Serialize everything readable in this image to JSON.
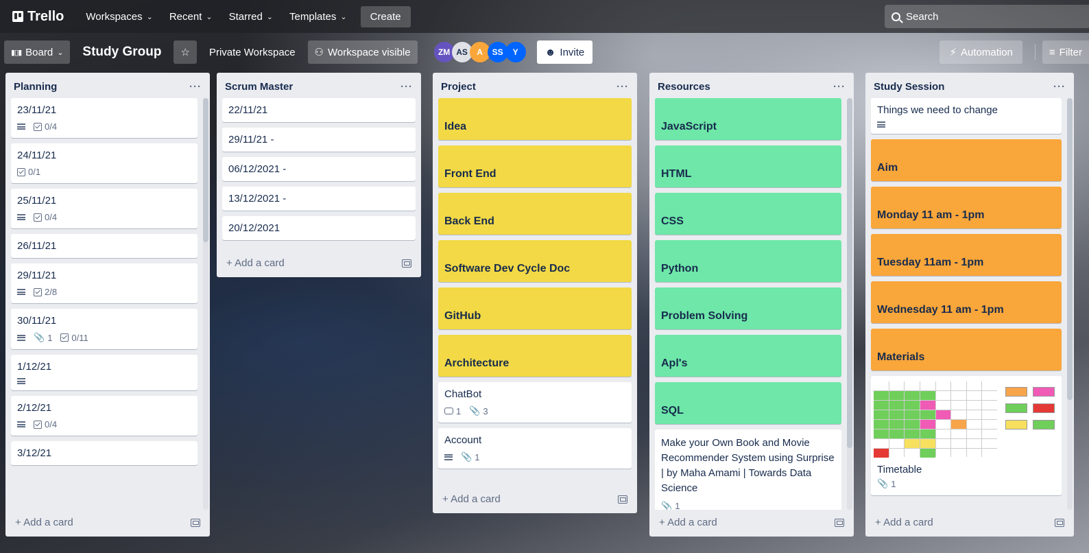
{
  "topnav": {
    "logo": "Trello",
    "items": [
      "Workspaces",
      "Recent",
      "Starred",
      "Templates"
    ],
    "create": "Create",
    "search": "Search"
  },
  "boardbar": {
    "view": "Board",
    "title": "Study Group",
    "workspace": "Private Workspace",
    "visibility": "Workspace visible",
    "avatars": [
      {
        "initials": "ZM",
        "color": "#6554c0"
      },
      {
        "initials": "AS",
        "color": "#dfe1e6"
      },
      {
        "initials": "A",
        "color": "#f9a63a"
      },
      {
        "initials": "SS",
        "color": "#0065ff"
      },
      {
        "initials": "Y",
        "color": "#0065ff"
      }
    ],
    "invite": "Invite",
    "automation": "Automation",
    "filter": "Filter"
  },
  "lists": {
    "planning": {
      "title": "Planning",
      "add": "Add a card",
      "cards": [
        {
          "title": "23/11/21",
          "checklist": "0/4"
        },
        {
          "title": "24/11/21",
          "checklist": "0/1"
        },
        {
          "title": "25/11/21",
          "checklist": "0/4"
        },
        {
          "title": "26/11/21"
        },
        {
          "title": "29/11/21",
          "checklist": "2/8"
        },
        {
          "title": "30/11/21",
          "attachments": "1",
          "checklist": "0/11"
        },
        {
          "title": "1/12/21"
        },
        {
          "title": "2/12/21",
          "checklist": "0/4"
        },
        {
          "title": "3/12/21"
        }
      ]
    },
    "scrum": {
      "title": "Scrum Master",
      "add": "Add a card",
      "cards": [
        "22/11/21",
        "29/11/21 -",
        "06/12/2021 -",
        "13/12/2021 -",
        "20/12/2021"
      ]
    },
    "project": {
      "title": "Project",
      "add": "Add a card",
      "cards": [
        "Idea",
        "Front End",
        "Back End",
        "Software Dev Cycle Doc",
        "GitHub",
        "Architecture"
      ],
      "chatbot": {
        "title": "ChatBot",
        "comments": "1",
        "attachments": "3"
      },
      "account": {
        "title": "Account",
        "attachments": "1"
      }
    },
    "resources": {
      "title": "Resources",
      "add": "Add a card",
      "cards": [
        "JavaScript",
        "HTML",
        "CSS",
        "Python",
        "Problem Solving",
        "Apl's",
        "SQL"
      ],
      "link_card": {
        "title": "Make your Own Book and Movie Recommender System using Surprise | by Maha Amami | Towards Data Science",
        "attachments": "1"
      }
    },
    "study": {
      "title": "Study Session",
      "add": "Add a card",
      "first": "Things we need to change",
      "cards": [
        "Aim",
        "Monday 11 am - 1pm",
        "Tuesday 11am - 1pm",
        "Wednesday 11 am - 1pm",
        "Materials"
      ],
      "timetable": {
        "title": "Timetable",
        "attachments": "1"
      }
    }
  },
  "colors": {
    "yellow": "#f2d945",
    "green": "#6ee7a8",
    "orange": "#f9a63a",
    "list_bg": "#ebecf0"
  }
}
